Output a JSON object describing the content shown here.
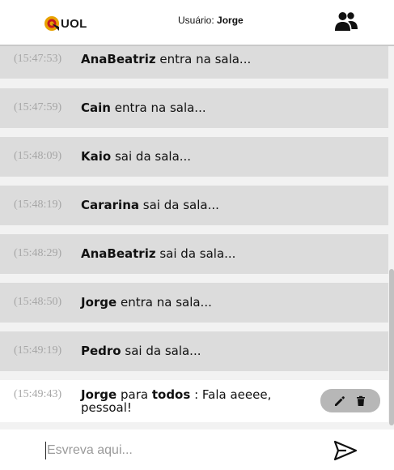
{
  "header": {
    "logo_text": "UOL",
    "user_prefix": "Usuário:",
    "user_name": "Jorge"
  },
  "messages": [
    {
      "time": "(15:47:53)",
      "user": "AnaBeatriz",
      "text": "entra na sala..."
    },
    {
      "time": "(15:47:59)",
      "user": "Cain",
      "text": "entra na sala..."
    },
    {
      "time": "(15:48:09)",
      "user": "Kaio",
      "text": "sai da sala..."
    },
    {
      "time": "(15:48:19)",
      "user": "Cararina",
      "text": "sai da sala..."
    },
    {
      "time": "(15:48:29)",
      "user": "AnaBeatriz",
      "text": "sai da sala..."
    },
    {
      "time": "(15:48:50)",
      "user": "Jorge",
      "text": "entra na sala..."
    },
    {
      "time": "(15:49:19)",
      "user": "Pedro",
      "text": "sai da sala..."
    }
  ],
  "private_message": {
    "time": "(15:49:43)",
    "from": "Jorge",
    "connector": "para",
    "to": "todos",
    "separator": ":",
    "text": "Fala aeeee, pessoal!"
  },
  "footer": {
    "placeholder": "Esvreva aqui..."
  },
  "icons": {
    "logo": "uol-logo-icon",
    "participants": "people-icon",
    "edit": "pencil-icon",
    "delete": "trash-icon",
    "send": "send-icon"
  }
}
